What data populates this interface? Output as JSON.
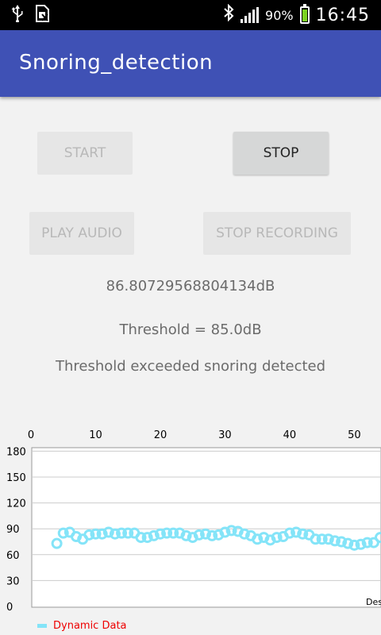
{
  "status_bar": {
    "left_icons": [
      "usb-icon",
      "sim-icon"
    ],
    "bluetooth_icon": "bluetooth-icon",
    "signal_icon": "signal-icon",
    "battery": "90%",
    "time": "16:45"
  },
  "app": {
    "title": "Snoring_detection",
    "accent": "#3f51b5"
  },
  "buttons": {
    "start": "START",
    "stop": "STOP",
    "play_audio": "PLAY AUDIO",
    "stop_recording": "STOP RECORDING"
  },
  "readouts": {
    "db_value": "86.80729568804134dB",
    "threshold": "Threshold = 85.0dB",
    "status": "Threshold exceeded snoring detected"
  },
  "chart_data": {
    "type": "scatter",
    "x_ticks": [
      "0",
      "10",
      "20",
      "30",
      "40",
      "50"
    ],
    "y_ticks": [
      "0",
      "30",
      "60",
      "90",
      "120",
      "150",
      "180"
    ],
    "xlim": [
      0,
      54
    ],
    "ylim": [
      0,
      185
    ],
    "x_axis_position": "top",
    "grid": "horizontal",
    "partial_label": "Des",
    "legend": {
      "position": "bottom-left",
      "label": "Dynamic Data",
      "color": "#84e4f8"
    },
    "series": [
      {
        "name": "Dynamic Data",
        "x": [
          4,
          5,
          6,
          7,
          8,
          9,
          10,
          11,
          12,
          13,
          14,
          15,
          16,
          17,
          18,
          19,
          20,
          21,
          22,
          23,
          24,
          25,
          26,
          27,
          28,
          29,
          30,
          31,
          32,
          33,
          34,
          35,
          36,
          37,
          38,
          39,
          40,
          41,
          42,
          43,
          44,
          45,
          46,
          47,
          48,
          49,
          50,
          51,
          52,
          53,
          54
        ],
        "y": [
          73,
          85,
          86,
          81,
          78,
          83,
          84,
          84,
          86,
          84,
          85,
          85,
          85,
          80,
          80,
          82,
          84,
          85,
          85,
          85,
          82,
          80,
          83,
          84,
          82,
          83,
          86,
          88,
          87,
          84,
          82,
          78,
          80,
          77,
          80,
          81,
          85,
          86,
          84,
          83,
          78,
          78,
          78,
          76,
          75,
          73,
          71,
          72,
          74,
          74,
          80
        ]
      }
    ]
  }
}
